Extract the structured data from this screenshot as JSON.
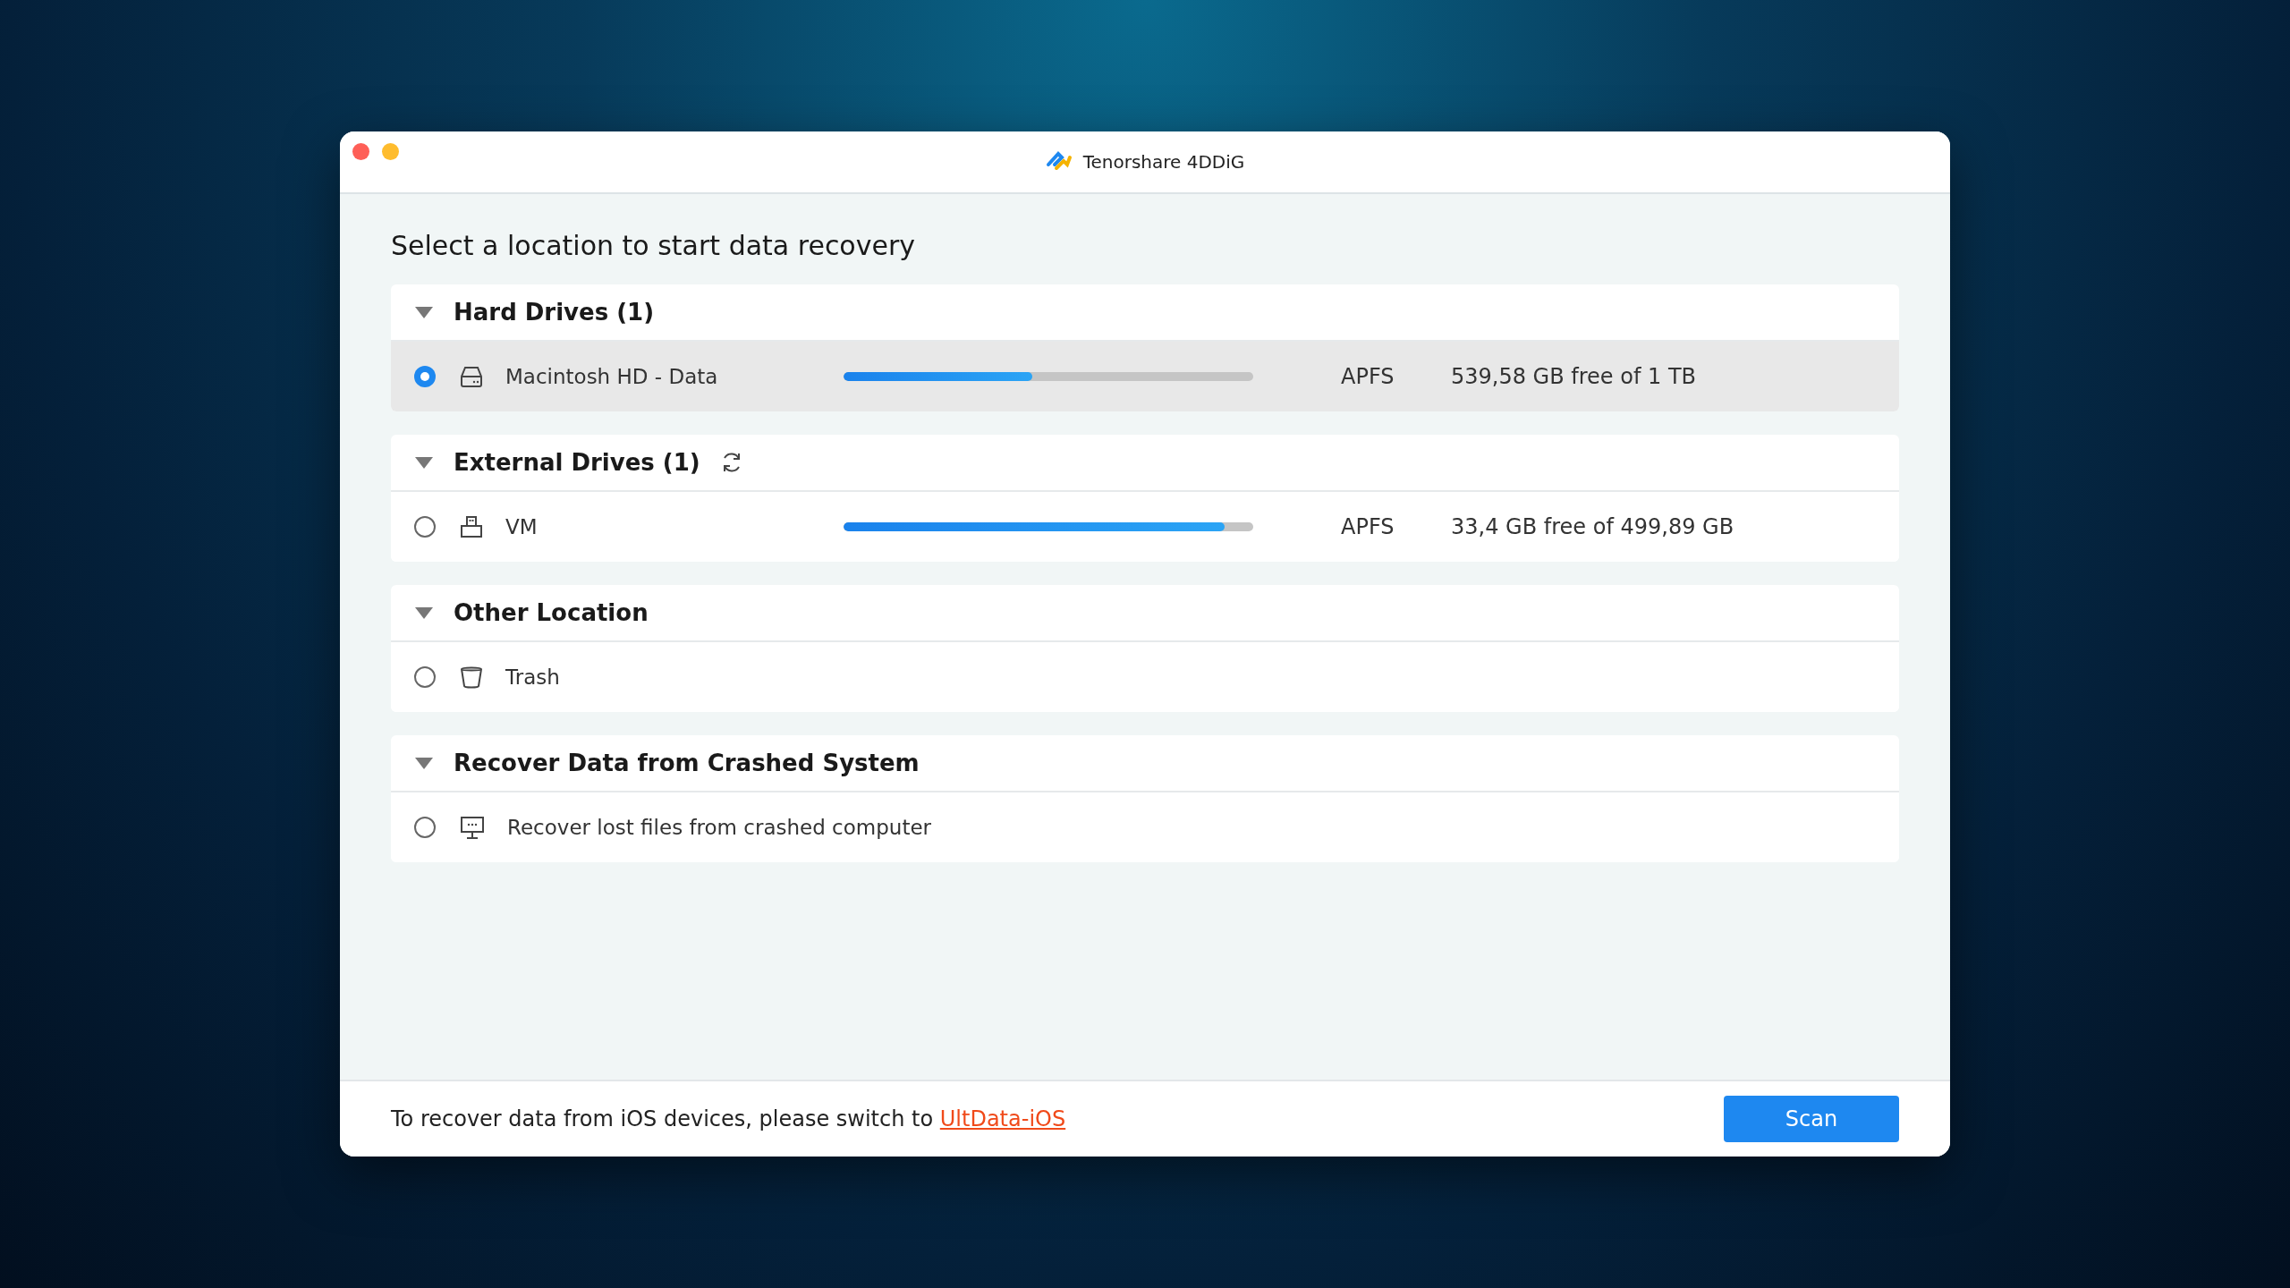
{
  "window": {
    "title": "Tenorshare 4DDiG"
  },
  "heading": "Select a location to start data recovery",
  "sections": [
    {
      "title": "Hard Drives (1)",
      "expanded": true,
      "refresh": false,
      "items": [
        {
          "kind": "internal-drive",
          "name": "Macintosh HD - Data",
          "selected": true,
          "level": 0.46,
          "filesystem": "APFS",
          "free": "539,58 GB free of 1 TB"
        }
      ]
    },
    {
      "title": "External Drives (1)",
      "expanded": true,
      "refresh": true,
      "items": [
        {
          "kind": "external-drive",
          "name": "VM",
          "selected": false,
          "level": 0.93,
          "filesystem": "APFS",
          "free": "33,4 GB free of 499,89 GB"
        }
      ]
    },
    {
      "title": "Other Location",
      "expanded": true,
      "refresh": false,
      "items": [
        {
          "kind": "trash",
          "name": "Trash",
          "selected": false
        }
      ]
    },
    {
      "title": "Recover Data from Crashed System",
      "expanded": true,
      "refresh": false,
      "items": [
        {
          "kind": "computer",
          "name": "Recover lost files from crashed computer",
          "selected": false
        }
      ]
    }
  ],
  "footer": {
    "text": "To recover data from iOS devices, please switch to ",
    "link": "UltData-iOS",
    "button": "Scan"
  }
}
